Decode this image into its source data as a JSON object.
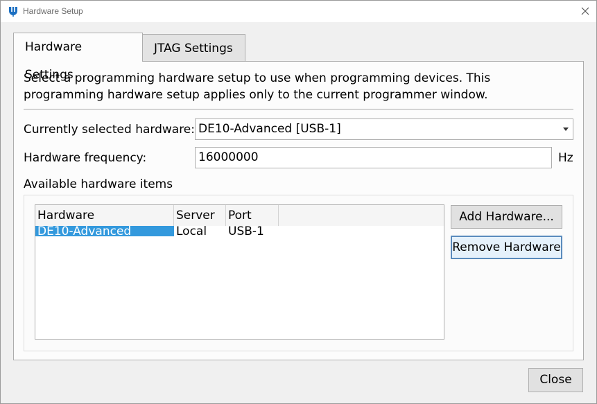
{
  "window": {
    "title": "Hardware Setup"
  },
  "tabs": [
    {
      "label": "Hardware Settings",
      "active": true
    },
    {
      "label": "JTAG Settings",
      "active": false
    }
  ],
  "description": "Select a programming hardware setup to use when programming devices. This programming hardware setup applies only to the current programmer window.",
  "current_hardware": {
    "label": "Currently selected hardware:",
    "value": "DE10-Advanced [USB-1]"
  },
  "frequency": {
    "label": "Hardware frequency:",
    "value": "16000000",
    "unit": "Hz"
  },
  "available": {
    "label": "Available hardware items",
    "columns": [
      "Hardware",
      "Server",
      "Port"
    ],
    "rows": [
      {
        "hardware": "DE10-Advanced",
        "server": "Local",
        "port": "USB-1",
        "selected": true
      }
    ]
  },
  "buttons": {
    "add": "Add Hardware...",
    "remove": "Remove Hardware",
    "close": "Close"
  },
  "colors": {
    "selection": "#3399dd",
    "focus_border": "#5a8bbd"
  }
}
